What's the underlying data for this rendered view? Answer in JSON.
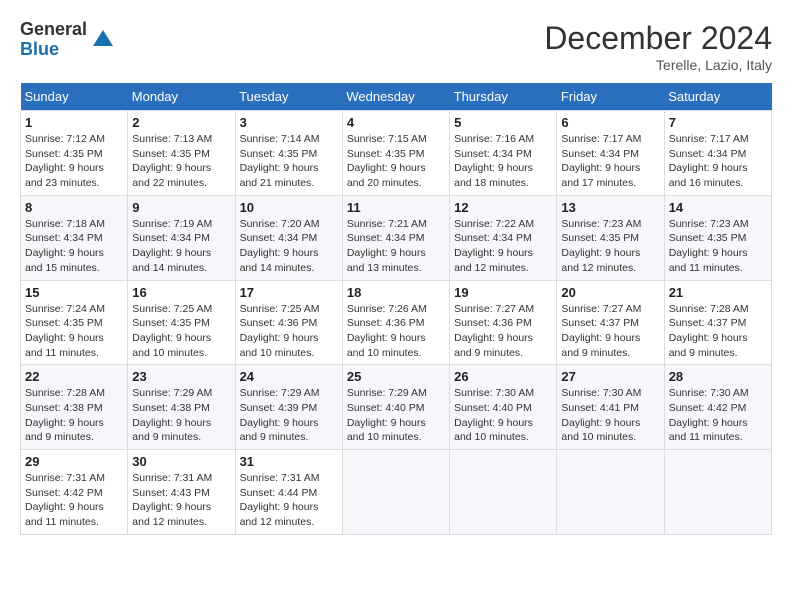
{
  "logo": {
    "general": "General",
    "blue": "Blue"
  },
  "title": "December 2024",
  "location": "Terelle, Lazio, Italy",
  "weekdays": [
    "Sunday",
    "Monday",
    "Tuesday",
    "Wednesday",
    "Thursday",
    "Friday",
    "Saturday"
  ],
  "weeks": [
    [
      {
        "day": "1",
        "sunrise": "7:12 AM",
        "sunset": "4:35 PM",
        "daylight": "9 hours and 23 minutes."
      },
      {
        "day": "2",
        "sunrise": "7:13 AM",
        "sunset": "4:35 PM",
        "daylight": "9 hours and 22 minutes."
      },
      {
        "day": "3",
        "sunrise": "7:14 AM",
        "sunset": "4:35 PM",
        "daylight": "9 hours and 21 minutes."
      },
      {
        "day": "4",
        "sunrise": "7:15 AM",
        "sunset": "4:35 PM",
        "daylight": "9 hours and 20 minutes."
      },
      {
        "day": "5",
        "sunrise": "7:16 AM",
        "sunset": "4:34 PM",
        "daylight": "9 hours and 18 minutes."
      },
      {
        "day": "6",
        "sunrise": "7:17 AM",
        "sunset": "4:34 PM",
        "daylight": "9 hours and 17 minutes."
      },
      {
        "day": "7",
        "sunrise": "7:17 AM",
        "sunset": "4:34 PM",
        "daylight": "9 hours and 16 minutes."
      }
    ],
    [
      {
        "day": "8",
        "sunrise": "7:18 AM",
        "sunset": "4:34 PM",
        "daylight": "9 hours and 15 minutes."
      },
      {
        "day": "9",
        "sunrise": "7:19 AM",
        "sunset": "4:34 PM",
        "daylight": "9 hours and 14 minutes."
      },
      {
        "day": "10",
        "sunrise": "7:20 AM",
        "sunset": "4:34 PM",
        "daylight": "9 hours and 14 minutes."
      },
      {
        "day": "11",
        "sunrise": "7:21 AM",
        "sunset": "4:34 PM",
        "daylight": "9 hours and 13 minutes."
      },
      {
        "day": "12",
        "sunrise": "7:22 AM",
        "sunset": "4:34 PM",
        "daylight": "9 hours and 12 minutes."
      },
      {
        "day": "13",
        "sunrise": "7:23 AM",
        "sunset": "4:35 PM",
        "daylight": "9 hours and 12 minutes."
      },
      {
        "day": "14",
        "sunrise": "7:23 AM",
        "sunset": "4:35 PM",
        "daylight": "9 hours and 11 minutes."
      }
    ],
    [
      {
        "day": "15",
        "sunrise": "7:24 AM",
        "sunset": "4:35 PM",
        "daylight": "9 hours and 11 minutes."
      },
      {
        "day": "16",
        "sunrise": "7:25 AM",
        "sunset": "4:35 PM",
        "daylight": "9 hours and 10 minutes."
      },
      {
        "day": "17",
        "sunrise": "7:25 AM",
        "sunset": "4:36 PM",
        "daylight": "9 hours and 10 minutes."
      },
      {
        "day": "18",
        "sunrise": "7:26 AM",
        "sunset": "4:36 PM",
        "daylight": "9 hours and 10 minutes."
      },
      {
        "day": "19",
        "sunrise": "7:27 AM",
        "sunset": "4:36 PM",
        "daylight": "9 hours and 9 minutes."
      },
      {
        "day": "20",
        "sunrise": "7:27 AM",
        "sunset": "4:37 PM",
        "daylight": "9 hours and 9 minutes."
      },
      {
        "day": "21",
        "sunrise": "7:28 AM",
        "sunset": "4:37 PM",
        "daylight": "9 hours and 9 minutes."
      }
    ],
    [
      {
        "day": "22",
        "sunrise": "7:28 AM",
        "sunset": "4:38 PM",
        "daylight": "9 hours and 9 minutes."
      },
      {
        "day": "23",
        "sunrise": "7:29 AM",
        "sunset": "4:38 PM",
        "daylight": "9 hours and 9 minutes."
      },
      {
        "day": "24",
        "sunrise": "7:29 AM",
        "sunset": "4:39 PM",
        "daylight": "9 hours and 9 minutes."
      },
      {
        "day": "25",
        "sunrise": "7:29 AM",
        "sunset": "4:40 PM",
        "daylight": "9 hours and 10 minutes."
      },
      {
        "day": "26",
        "sunrise": "7:30 AM",
        "sunset": "4:40 PM",
        "daylight": "9 hours and 10 minutes."
      },
      {
        "day": "27",
        "sunrise": "7:30 AM",
        "sunset": "4:41 PM",
        "daylight": "9 hours and 10 minutes."
      },
      {
        "day": "28",
        "sunrise": "7:30 AM",
        "sunset": "4:42 PM",
        "daylight": "9 hours and 11 minutes."
      }
    ],
    [
      {
        "day": "29",
        "sunrise": "7:31 AM",
        "sunset": "4:42 PM",
        "daylight": "9 hours and 11 minutes."
      },
      {
        "day": "30",
        "sunrise": "7:31 AM",
        "sunset": "4:43 PM",
        "daylight": "9 hours and 12 minutes."
      },
      {
        "day": "31",
        "sunrise": "7:31 AM",
        "sunset": "4:44 PM",
        "daylight": "9 hours and 12 minutes."
      },
      null,
      null,
      null,
      null
    ]
  ]
}
